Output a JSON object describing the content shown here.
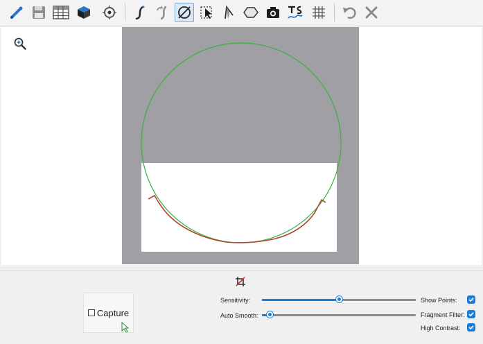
{
  "toolbar": {
    "tools": [
      {
        "icon": "pen-tool-icon"
      },
      {
        "icon": "save-icon"
      },
      {
        "icon": "table-icon"
      },
      {
        "icon": "cube-icon"
      },
      {
        "icon": "target-icon"
      },
      {
        "icon": "freehand-curve-icon"
      },
      {
        "icon": "redraw-curve-icon"
      },
      {
        "icon": "circle-fit-icon",
        "active": true
      },
      {
        "icon": "select-point-icon"
      },
      {
        "icon": "angle-icon"
      },
      {
        "icon": "polygon-icon"
      },
      {
        "icon": "camera-icon"
      },
      {
        "icon": "text-tool-icon"
      },
      {
        "icon": "grid-icon"
      },
      {
        "icon": "undo-icon"
      },
      {
        "icon": "close-icon"
      }
    ]
  },
  "controls": {
    "capture_label": "Capture",
    "sensitivity_label": "Sensitivity:",
    "sensitivity_value": 0.5,
    "auto_smooth_label": "Auto Smooth:",
    "auto_smooth_value": 0.05,
    "show_points_label": "Show Points:",
    "show_points_checked": true,
    "fragment_filter_label": "Fragment Filter:",
    "fragment_filter_checked": true,
    "high_contrast_label": "High Contrast:",
    "high_contrast_checked": true
  },
  "colors": {
    "accent": "#1a7ed8",
    "fitted_circle": "#3cb043",
    "traced_edge": "#b0462c",
    "image_background": "#a09fa3"
  }
}
